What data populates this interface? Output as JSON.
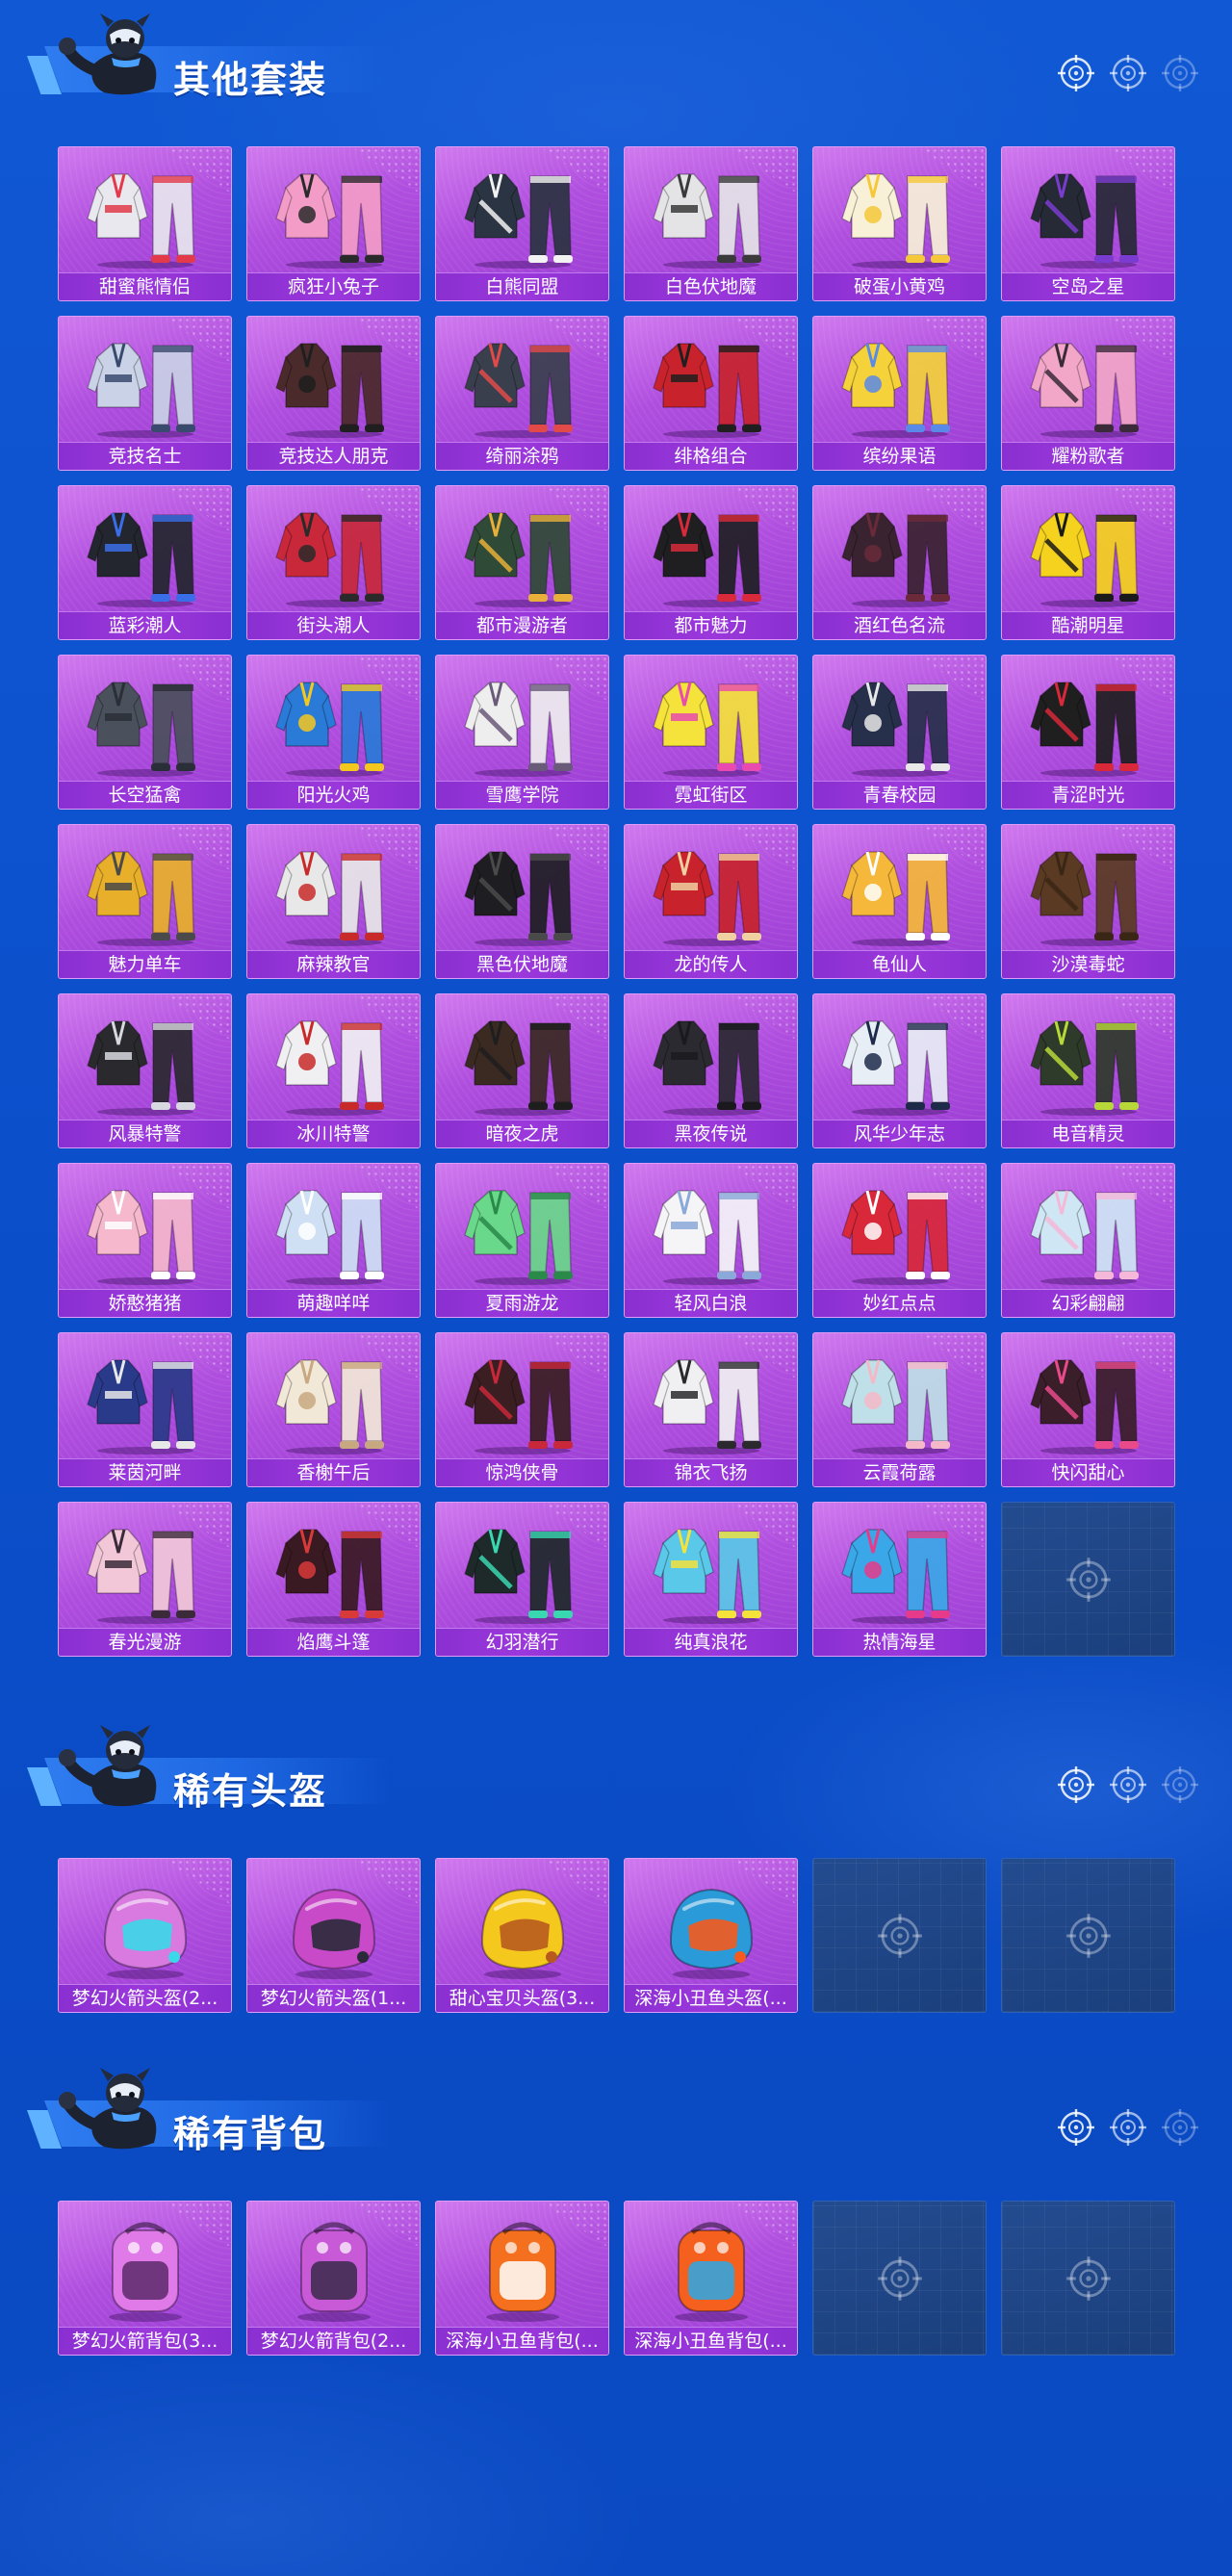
{
  "sections": [
    {
      "title": "其他套装",
      "icon": "mascot-icon",
      "items": [
        {
          "name": "甜蜜熊情侣",
          "color": "#e8e8ee",
          "accent": "#e23a4a"
        },
        {
          "name": "疯狂小兔子",
          "color": "#f39cc8",
          "accent": "#2a2a2a"
        },
        {
          "name": "白熊同盟",
          "color": "#2b3442",
          "accent": "#f2f2f2"
        },
        {
          "name": "白色伏地魔",
          "color": "#e4e4e6",
          "accent": "#3a3a3a"
        },
        {
          "name": "破蛋小黄鸡",
          "color": "#f8f1d8",
          "accent": "#f5c83a"
        },
        {
          "name": "空岛之星",
          "color": "#262a36",
          "accent": "#7a3cd0"
        },
        {
          "name": "竞技名士",
          "color": "#c9d2e6",
          "accent": "#3a4a6e"
        },
        {
          "name": "竞技达人朋克",
          "color": "#4a2a2a",
          "accent": "#1f1f1f"
        },
        {
          "name": "绮丽涂鸦",
          "color": "#3a3f4e",
          "accent": "#e24a4a"
        },
        {
          "name": "绯格组合",
          "color": "#c8232c",
          "accent": "#1f1f1f"
        },
        {
          "name": "缤纷果语",
          "color": "#f5d23a",
          "accent": "#5a8ae8"
        },
        {
          "name": "耀粉歌者",
          "color": "#f2a6c8",
          "accent": "#3a2a3a"
        },
        {
          "name": "蓝彩潮人",
          "color": "#23262e",
          "accent": "#3a6ee8"
        },
        {
          "name": "街头潮人",
          "color": "#c8283a",
          "accent": "#2a2a2a"
        },
        {
          "name": "都市漫游者",
          "color": "#2f4a36",
          "accent": "#e8b03a"
        },
        {
          "name": "都市魅力",
          "color": "#1f1f22",
          "accent": "#d82a3a"
        },
        {
          "name": "酒红色名流",
          "color": "#3a2330",
          "accent": "#6a2a3a"
        },
        {
          "name": "酷潮明星",
          "color": "#f5d21e",
          "accent": "#1a1a1a"
        },
        {
          "name": "长空猛禽",
          "color": "#4a505c",
          "accent": "#2a2e36"
        },
        {
          "name": "阳光火鸡",
          "color": "#2a7ad8",
          "accent": "#f5c81e"
        },
        {
          "name": "雪鹰学院",
          "color": "#eeeeee",
          "accent": "#6a5a7a"
        },
        {
          "name": "霓虹街区",
          "color": "#f5e23a",
          "accent": "#e84ab0"
        },
        {
          "name": "青春校园",
          "color": "#26304a",
          "accent": "#e8e8e8"
        },
        {
          "name": "青涩时光",
          "color": "#1f1f1f",
          "accent": "#d8283a"
        },
        {
          "name": "魅力单车",
          "color": "#e8b02a",
          "accent": "#4a4a4a"
        },
        {
          "name": "麻辣教官",
          "color": "#e8e8e8",
          "accent": "#c82a2a"
        },
        {
          "name": "黑色伏地魔",
          "color": "#1e1e22",
          "accent": "#4a4a4a"
        },
        {
          "name": "龙的传人",
          "color": "#c8232c",
          "accent": "#f0d0a0"
        },
        {
          "name": "龟仙人",
          "color": "#f5b83a",
          "accent": "#ffffff"
        },
        {
          "name": "沙漠毒蛇",
          "color": "#5a3a22",
          "accent": "#3a2614"
        },
        {
          "name": "风暴特警",
          "color": "#2a2a2e",
          "accent": "#d8d8e0"
        },
        {
          "name": "冰川特警",
          "color": "#f0f0f2",
          "accent": "#c82a2a"
        },
        {
          "name": "暗夜之虎",
          "color": "#3a2a22",
          "accent": "#1e1e1e"
        },
        {
          "name": "黑夜传说",
          "color": "#2a2a30",
          "accent": "#1a1a1e"
        },
        {
          "name": "风华少年志",
          "color": "#e8eef5",
          "accent": "#1e2a4a"
        },
        {
          "name": "电音精灵",
          "color": "#2e3a2a",
          "accent": "#b8d83a"
        },
        {
          "name": "娇憨猪猪",
          "color": "#f5b8cc",
          "accent": "#ffffff"
        },
        {
          "name": "萌趣咩咩",
          "color": "#cfe0f5",
          "accent": "#ffffff"
        },
        {
          "name": "夏雨游龙",
          "color": "#6ad88a",
          "accent": "#2a8a4a"
        },
        {
          "name": "轻风白浪",
          "color": "#f5f5f8",
          "accent": "#8aa8d8"
        },
        {
          "name": "妙红点点",
          "color": "#d8283a",
          "accent": "#ffffff"
        },
        {
          "name": "幻彩翩翩",
          "color": "#cfe6f5",
          "accent": "#f5b8d8"
        },
        {
          "name": "莱茵河畔",
          "color": "#2a3a8a",
          "accent": "#e8e8e8"
        },
        {
          "name": "香榭午后",
          "color": "#f2e8d8",
          "accent": "#c8a880"
        },
        {
          "name": "惊鸿侠骨",
          "color": "#3a1e22",
          "accent": "#c8283a"
        },
        {
          "name": "锦衣飞扬",
          "color": "#f0f0f2",
          "accent": "#2a2a2e"
        },
        {
          "name": "云霞荷露",
          "color": "#bfe0e8",
          "accent": "#f5b8c8"
        },
        {
          "name": "快闪甜心",
          "color": "#3a1e2a",
          "accent": "#e84a8a"
        },
        {
          "name": "春光漫游",
          "color": "#f2c8d8",
          "accent": "#3a2a3a"
        },
        {
          "name": "焰鹰斗篷",
          "color": "#3a1a22",
          "accent": "#d83a3a"
        },
        {
          "name": "幻羽潜行",
          "color": "#1e2a2a",
          "accent": "#3ad8b0"
        },
        {
          "name": "纯真浪花",
          "color": "#5ac8e8",
          "accent": "#f5e23a"
        },
        {
          "name": "热情海星",
          "color": "#3aa8e8",
          "accent": "#e83a8a"
        }
      ],
      "empty_slots": 1
    },
    {
      "title": "稀有头盔",
      "icon": "mascot-icon",
      "items": [
        {
          "name": "梦幻火箭头盔(2...",
          "color": "#d87ae0",
          "accent": "#3ad8e8"
        },
        {
          "name": "梦幻火箭头盔(1...",
          "color": "#c84ac8",
          "accent": "#2a2a3a"
        },
        {
          "name": "甜心宝贝头盔(3...",
          "color": "#f5c81e",
          "accent": "#b85a1e"
        },
        {
          "name": "深海小丑鱼头盔(...",
          "color": "#2a9ad8",
          "accent": "#f55a1e"
        }
      ],
      "empty_slots": 2
    },
    {
      "title": "稀有背包",
      "icon": "mascot-icon",
      "items": [
        {
          "name": "梦幻火箭背包(3...",
          "color": "#e07ae8",
          "accent": "#5a2a6a"
        },
        {
          "name": "梦幻火箭背包(2...",
          "color": "#c85ad8",
          "accent": "#3a2a4a"
        },
        {
          "name": "深海小丑鱼背包(...",
          "color": "#f5701e",
          "accent": "#ffffff"
        },
        {
          "name": "深海小丑鱼背包(...",
          "color": "#f5601e",
          "accent": "#2aa8e8"
        }
      ],
      "empty_slots": 2
    }
  ],
  "header_icons": [
    "crosshair-icon",
    "crosshair-icon",
    "crosshair-icon"
  ],
  "empty_slot_icon": "crosshair-icon",
  "theme": {
    "background": "#0d54cf",
    "card_purple": "#b04fdf",
    "label_bar": "#8a2fd1",
    "empty_card": "#1b3f7c"
  }
}
